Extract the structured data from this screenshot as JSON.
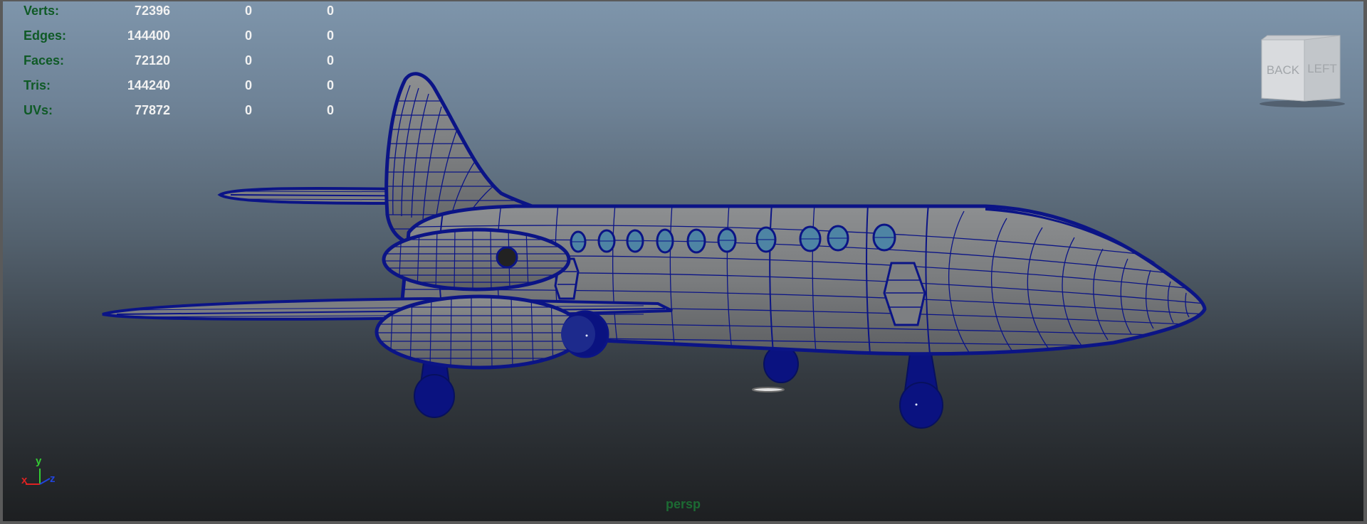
{
  "viewport": {
    "camera": "persp",
    "background_top": "#7e95ab",
    "background_bottom": "#1d1f21"
  },
  "hud": {
    "label_color": "#0f5a26",
    "value_color": "#f2f2f2",
    "rows": [
      {
        "label": "Verts:",
        "total": "72396",
        "selected": "0",
        "component": "0"
      },
      {
        "label": "Edges:",
        "total": "144400",
        "selected": "0",
        "component": "0"
      },
      {
        "label": "Faces:",
        "total": "72120",
        "selected": "0",
        "component": "0"
      },
      {
        "label": "Tris:",
        "total": "144240",
        "selected": "0",
        "component": "0"
      },
      {
        "label": "UVs:",
        "total": "77872",
        "selected": "0",
        "component": "0"
      }
    ]
  },
  "viewcube": {
    "face_back": "BACK",
    "face_left": "LEFT"
  },
  "axis_indicator": {
    "x": "x",
    "y": "y",
    "z": "z"
  },
  "model": {
    "wireframe_color": "#0b1486",
    "shaded_color": "#7b7d7f",
    "icon": "jet-airplane-wireframe"
  }
}
